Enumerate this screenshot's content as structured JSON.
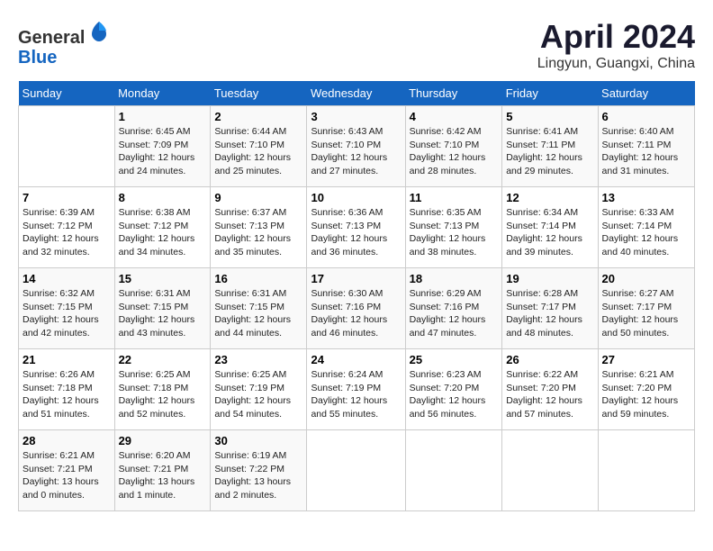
{
  "logo": {
    "general": "General",
    "blue": "Blue"
  },
  "title": "April 2024",
  "location": "Lingyun, Guangxi, China",
  "days_header": [
    "Sunday",
    "Monday",
    "Tuesday",
    "Wednesday",
    "Thursday",
    "Friday",
    "Saturday"
  ],
  "weeks": [
    [
      {
        "day": "",
        "info": ""
      },
      {
        "day": "1",
        "info": "Sunrise: 6:45 AM\nSunset: 7:09 PM\nDaylight: 12 hours\nand 24 minutes."
      },
      {
        "day": "2",
        "info": "Sunrise: 6:44 AM\nSunset: 7:10 PM\nDaylight: 12 hours\nand 25 minutes."
      },
      {
        "day": "3",
        "info": "Sunrise: 6:43 AM\nSunset: 7:10 PM\nDaylight: 12 hours\nand 27 minutes."
      },
      {
        "day": "4",
        "info": "Sunrise: 6:42 AM\nSunset: 7:10 PM\nDaylight: 12 hours\nand 28 minutes."
      },
      {
        "day": "5",
        "info": "Sunrise: 6:41 AM\nSunset: 7:11 PM\nDaylight: 12 hours\nand 29 minutes."
      },
      {
        "day": "6",
        "info": "Sunrise: 6:40 AM\nSunset: 7:11 PM\nDaylight: 12 hours\nand 31 minutes."
      }
    ],
    [
      {
        "day": "7",
        "info": "Sunrise: 6:39 AM\nSunset: 7:12 PM\nDaylight: 12 hours\nand 32 minutes."
      },
      {
        "day": "8",
        "info": "Sunrise: 6:38 AM\nSunset: 7:12 PM\nDaylight: 12 hours\nand 34 minutes."
      },
      {
        "day": "9",
        "info": "Sunrise: 6:37 AM\nSunset: 7:13 PM\nDaylight: 12 hours\nand 35 minutes."
      },
      {
        "day": "10",
        "info": "Sunrise: 6:36 AM\nSunset: 7:13 PM\nDaylight: 12 hours\nand 36 minutes."
      },
      {
        "day": "11",
        "info": "Sunrise: 6:35 AM\nSunset: 7:13 PM\nDaylight: 12 hours\nand 38 minutes."
      },
      {
        "day": "12",
        "info": "Sunrise: 6:34 AM\nSunset: 7:14 PM\nDaylight: 12 hours\nand 39 minutes."
      },
      {
        "day": "13",
        "info": "Sunrise: 6:33 AM\nSunset: 7:14 PM\nDaylight: 12 hours\nand 40 minutes."
      }
    ],
    [
      {
        "day": "14",
        "info": "Sunrise: 6:32 AM\nSunset: 7:15 PM\nDaylight: 12 hours\nand 42 minutes."
      },
      {
        "day": "15",
        "info": "Sunrise: 6:31 AM\nSunset: 7:15 PM\nDaylight: 12 hours\nand 43 minutes."
      },
      {
        "day": "16",
        "info": "Sunrise: 6:31 AM\nSunset: 7:15 PM\nDaylight: 12 hours\nand 44 minutes."
      },
      {
        "day": "17",
        "info": "Sunrise: 6:30 AM\nSunset: 7:16 PM\nDaylight: 12 hours\nand 46 minutes."
      },
      {
        "day": "18",
        "info": "Sunrise: 6:29 AM\nSunset: 7:16 PM\nDaylight: 12 hours\nand 47 minutes."
      },
      {
        "day": "19",
        "info": "Sunrise: 6:28 AM\nSunset: 7:17 PM\nDaylight: 12 hours\nand 48 minutes."
      },
      {
        "day": "20",
        "info": "Sunrise: 6:27 AM\nSunset: 7:17 PM\nDaylight: 12 hours\nand 50 minutes."
      }
    ],
    [
      {
        "day": "21",
        "info": "Sunrise: 6:26 AM\nSunset: 7:18 PM\nDaylight: 12 hours\nand 51 minutes."
      },
      {
        "day": "22",
        "info": "Sunrise: 6:25 AM\nSunset: 7:18 PM\nDaylight: 12 hours\nand 52 minutes."
      },
      {
        "day": "23",
        "info": "Sunrise: 6:25 AM\nSunset: 7:19 PM\nDaylight: 12 hours\nand 54 minutes."
      },
      {
        "day": "24",
        "info": "Sunrise: 6:24 AM\nSunset: 7:19 PM\nDaylight: 12 hours\nand 55 minutes."
      },
      {
        "day": "25",
        "info": "Sunrise: 6:23 AM\nSunset: 7:20 PM\nDaylight: 12 hours\nand 56 minutes."
      },
      {
        "day": "26",
        "info": "Sunrise: 6:22 AM\nSunset: 7:20 PM\nDaylight: 12 hours\nand 57 minutes."
      },
      {
        "day": "27",
        "info": "Sunrise: 6:21 AM\nSunset: 7:20 PM\nDaylight: 12 hours\nand 59 minutes."
      }
    ],
    [
      {
        "day": "28",
        "info": "Sunrise: 6:21 AM\nSunset: 7:21 PM\nDaylight: 13 hours\nand 0 minutes."
      },
      {
        "day": "29",
        "info": "Sunrise: 6:20 AM\nSunset: 7:21 PM\nDaylight: 13 hours\nand 1 minute."
      },
      {
        "day": "30",
        "info": "Sunrise: 6:19 AM\nSunset: 7:22 PM\nDaylight: 13 hours\nand 2 minutes."
      },
      {
        "day": "",
        "info": ""
      },
      {
        "day": "",
        "info": ""
      },
      {
        "day": "",
        "info": ""
      },
      {
        "day": "",
        "info": ""
      }
    ]
  ]
}
